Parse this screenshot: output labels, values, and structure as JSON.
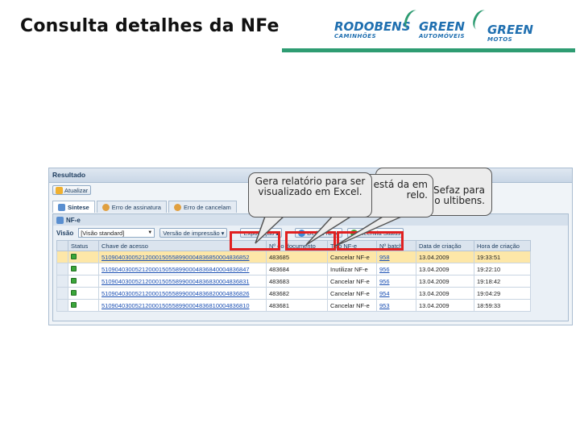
{
  "slide": {
    "title": "Consulta detalhes da NFe",
    "brand_color": "#2e9c72",
    "logos": [
      {
        "name": "RODOBENS",
        "sub": "CAMINHÕES"
      },
      {
        "name": "GREEN",
        "sub": "AUTOMÓVEIS"
      },
      {
        "name": "GREEN",
        "sub": "MOTOS"
      }
    ]
  },
  "sap": {
    "header": "Resultado",
    "refresh_label": "Atualizar",
    "tabs": [
      {
        "label": "Síntese",
        "icon": "summary-icon",
        "active": true
      },
      {
        "label": "Erro de assinatura",
        "icon": "error-icon",
        "active": false
      },
      {
        "label": "Erro de cancelam",
        "icon": "error-icon",
        "active": false
      }
    ],
    "panel_title": "NF-e",
    "view_label": "Visão",
    "view_value": "[Visão standard]",
    "print_version_label": "Versão de impressão",
    "export_label": "Exportação",
    "details_label": "Detlhs NF-e",
    "resend_label": "Reenvia Status",
    "columns": [
      "Status",
      "Chave de acesso",
      "Nº do documento",
      "Tipo NF-e",
      "Nº batch",
      "Data de criação",
      "Hora de criação"
    ],
    "rows": [
      {
        "key": "51090403005212000150558990004836850004836852",
        "doc": "483685",
        "type": "Cancelar NF-e",
        "batch": "958",
        "date": "13.04.2009",
        "time": "19:33:51",
        "selected": true
      },
      {
        "key": "51090403005212000150558990004836840004836847",
        "doc": "483684",
        "type": "Inutilizar NF-e",
        "batch": "956",
        "date": "13.04.2009",
        "time": "19:22:10",
        "selected": false
      },
      {
        "key": "51090403005212000150558990004836830004836831",
        "doc": "483683",
        "type": "Cancelar NF-e",
        "batch": "956",
        "date": "13.04.2009",
        "time": "19:18:42",
        "selected": false
      },
      {
        "key": "51090403005212000150558990004836820004836826",
        "doc": "483682",
        "type": "Cancelar NF-e",
        "batch": "954",
        "date": "13.04.2009",
        "time": "19:04:29",
        "selected": false
      },
      {
        "key": "51090403005212000150558990004836810004836810",
        "doc": "483681",
        "type": "Cancelar NF-e",
        "batch": "953",
        "date": "13.04.2009",
        "time": "18:59:33",
        "selected": false
      }
    ]
  },
  "callouts": {
    "export": "Gera relatório para ser visualizado em Excel.",
    "details_visible": "que está da em relo.",
    "resend_visible": "retorno a Sefaz para o ultibens."
  }
}
